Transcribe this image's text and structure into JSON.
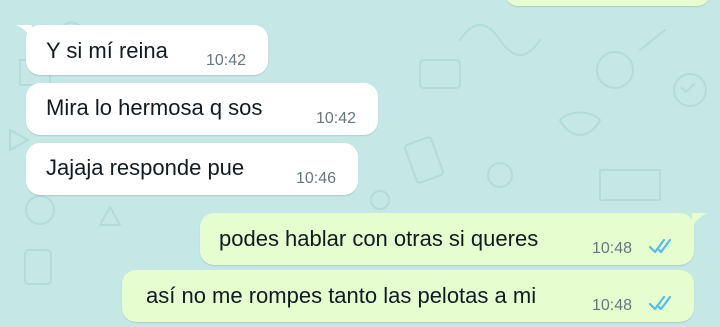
{
  "theme": {
    "wallpaper_color": "#c5e7e6",
    "incoming_bubble_color": "#ffffff",
    "outgoing_bubble_color": "#e6fdd0",
    "read_receipt_color": "#53bdeb"
  },
  "chat": {
    "messages": [
      {
        "direction": "incoming",
        "text": "Y si mí reina",
        "time": "10:42"
      },
      {
        "direction": "incoming",
        "text": "Mira lo hermosa q sos",
        "time": "10:42"
      },
      {
        "direction": "incoming",
        "text": "Jajaja responde pue",
        "time": "10:46"
      },
      {
        "direction": "outgoing",
        "text": "podes hablar con otras si queres",
        "time": "10:48",
        "status_icon": "double-check-read-icon"
      },
      {
        "direction": "outgoing",
        "text": "así no me rompes tanto las pelotas a mi",
        "time": "10:48",
        "status_icon": "double-check-read-icon"
      }
    ]
  }
}
